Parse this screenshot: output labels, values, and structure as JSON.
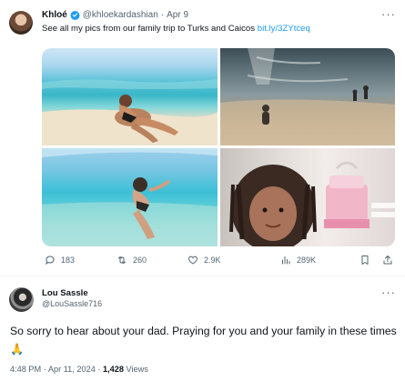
{
  "quoted_tweet": {
    "author_name": "Khloé",
    "handle": "@khloekardashian",
    "separator": "·",
    "date": "Apr 9",
    "more_label": "···",
    "text": "See all my pics from our family trip to Turks and Caicos",
    "link": "bit.ly/3ZYtceq",
    "actions": {
      "replies": "183",
      "retweets": "260",
      "likes": "2.9K",
      "views": "289K"
    }
  },
  "reply_tweet": {
    "author_name": "Lou Sassle",
    "handle": "@LouSassle716",
    "more_label": "···",
    "text": "So sorry to hear about your dad. Praying for you and your family in these times 🙏",
    "time": "4:48 PM · Apr 11, 2024 · ",
    "views_count": "1,428",
    "views_label": " Views"
  },
  "colors": {
    "accent": "#1d9bf0",
    "secondary_text": "#536471",
    "primary_text": "#0f1419"
  },
  "icons": [
    "verified-badge-icon",
    "reply-icon",
    "retweet-icon",
    "like-icon",
    "views-icon",
    "bookmark-icon",
    "share-icon",
    "more-icon"
  ]
}
